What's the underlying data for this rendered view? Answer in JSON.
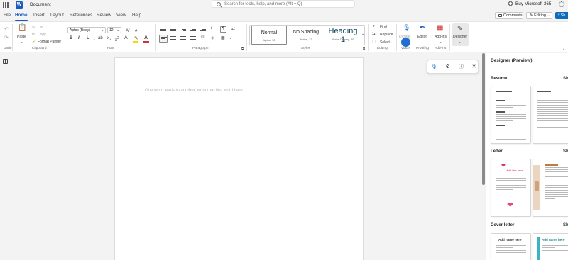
{
  "title_bar": {
    "document_title": "Document",
    "search_placeholder": "Search for tools, help, and more (Alt + Q)",
    "buy_label": "Buy Microsoft 365",
    "app_icon": "word-logo-icon"
  },
  "menu": {
    "tabs": [
      "File",
      "Home",
      "Insert",
      "Layout",
      "References",
      "Review",
      "View",
      "Help"
    ],
    "active_tab": "Home",
    "comments_label": "Comments",
    "editing_label": "Editing",
    "share_label": "Sh"
  },
  "ribbon": {
    "undo_group_label": "Undo",
    "clipboard": {
      "paste": "Paste",
      "cut": "Cut",
      "copy": "Copy",
      "format_painter": "Format Painter",
      "label": "Clipboard"
    },
    "font": {
      "font_name": "Aptos (Body)",
      "font_size": "12",
      "bold": "B",
      "italic": "I",
      "underline": "U",
      "label": "Font"
    },
    "paragraph": {
      "label": "Paragraph"
    },
    "styles": {
      "items": [
        {
          "name": "Normal",
          "sub": "Aptos, 12"
        },
        {
          "name": "No Spacing",
          "sub": "Aptos, 12"
        },
        {
          "name": "Heading 1",
          "sub": "Aptos Display, 20"
        }
      ],
      "label": "Styles"
    },
    "editing": {
      "find": "Find",
      "replace": "Replace",
      "select": "Select",
      "label": "Editing"
    },
    "voice": {
      "dictate": "Dictate",
      "label": "Voice"
    },
    "proofing": {
      "editor": "Editor",
      "label": "Proofing"
    },
    "addins": {
      "addins": "Add-ins",
      "label": "Add-ins"
    },
    "designer": {
      "designer": "Designer"
    },
    "accent_color": "#185abd",
    "font_color": "#d13438",
    "highlight_color": "#ffd500"
  },
  "document": {
    "placeholder": "One word leads to another, write that first word here..."
  },
  "designer_pane": {
    "title": "Designer (Preview)",
    "sections": [
      {
        "name": "Resume",
        "action": "Sh"
      },
      {
        "name": "Letter",
        "action": "Sh"
      },
      {
        "name": "Cover letter",
        "action": "Sh"
      }
    ],
    "thumbnails": {
      "letter_1_heading": "Add title here",
      "cover_1_heading": "Add name here",
      "cover_2_heading": "Add name here"
    }
  }
}
